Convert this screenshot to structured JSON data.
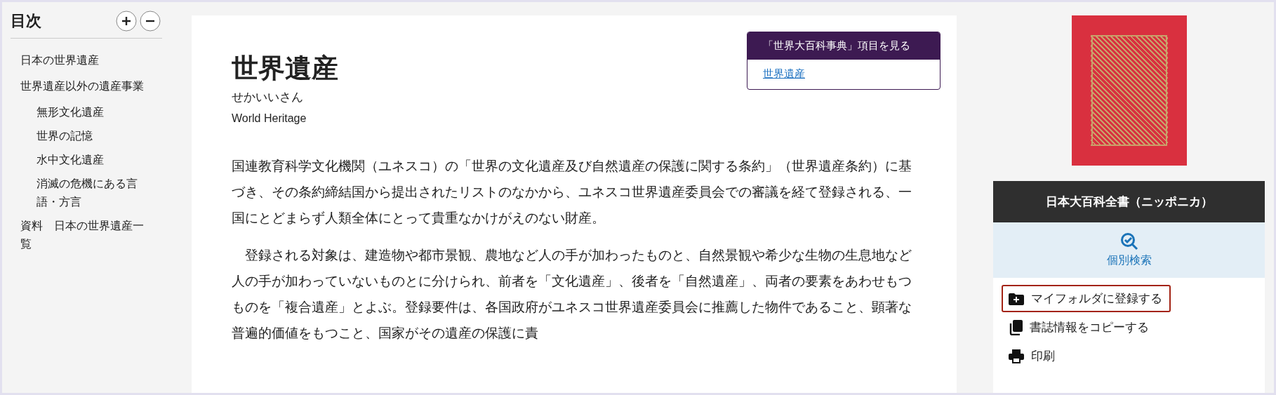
{
  "toc": {
    "title": "目次",
    "items": [
      {
        "label": "日本の世界遺産"
      },
      {
        "label": "世界遺産以外の遺産事業",
        "children": [
          {
            "label": "無形文化遺産"
          },
          {
            "label": "世界の記憶"
          },
          {
            "label": "水中文化遺産"
          },
          {
            "label": "消滅の危機にある言語・方言"
          }
        ]
      },
      {
        "label": "資料　日本の世界遺産一覧"
      }
    ]
  },
  "article": {
    "title": "世界遺産",
    "reading": "せかいいさん",
    "english": "World Heritage",
    "paragraphs": [
      "国連教育科学文化機関（ユネスコ）の「世界の文化遺産及び自然遺産の保護に関する条約」（世界遺産条約）に基づき、その条約締結国から提出されたリストのなかから、ユネスコ世界遺産委員会での審議を経て登録される、一国にとどまらず人類全体にとって貴重なかけがえのない財産。",
      "登録される対象は、建造物や都市景観、農地など人の手が加わったものと、自然景観や希少な生物の生息地など人の手が加わっていないものとに分けられ、前者を「文化遺産」、後者を「自然遺産」、両者の要素をあわせもつものを「複合遺産」とよぶ。登録要件は、各国政府がユネスコ世界遺産委員会に推薦した物件であること、顕著な普遍的価値をもつこと、国家がその遺産の保護に責"
    ]
  },
  "related": {
    "title": "「世界大百科事典」項目を見る",
    "links": [
      "世界遺産"
    ]
  },
  "source": {
    "title": "日本大百科全書（ニッポニカ）",
    "search": "個別検索",
    "actions": [
      {
        "kind": "folder",
        "label": "マイフォルダに登録する",
        "focused": true
      },
      {
        "kind": "copy",
        "label": "書誌情報をコピーする",
        "focused": false
      },
      {
        "kind": "print",
        "label": "印刷",
        "focused": false
      }
    ]
  }
}
